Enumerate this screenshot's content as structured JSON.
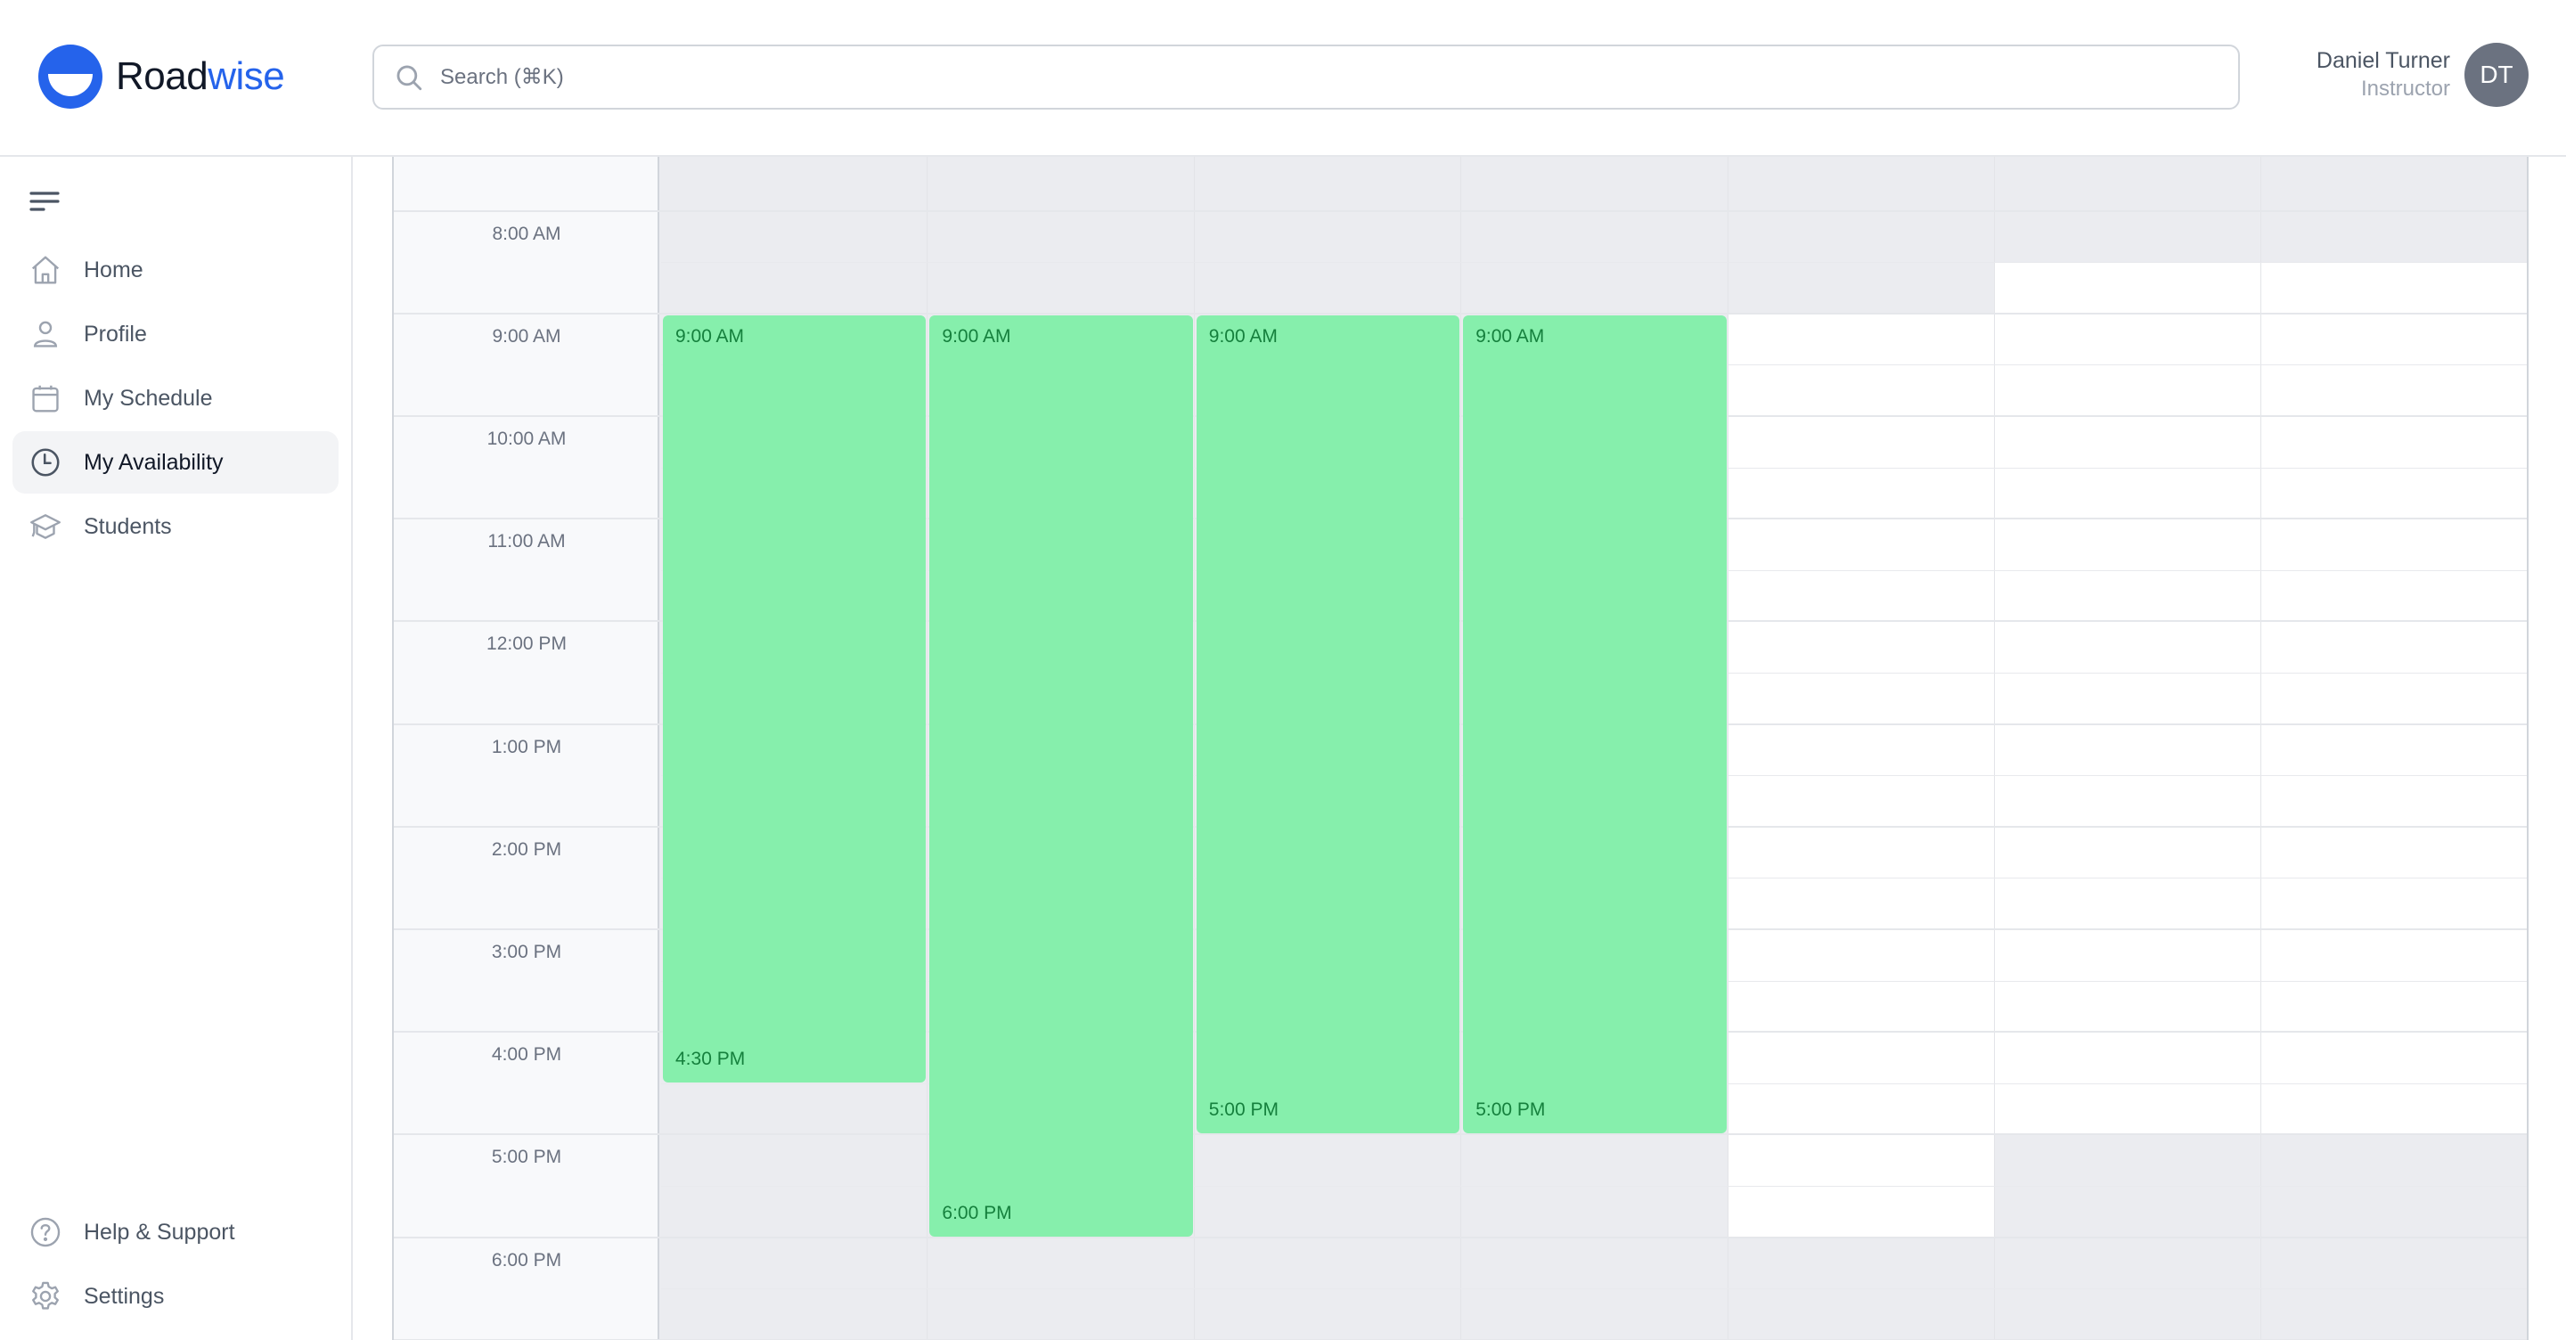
{
  "header": {
    "brand_part1": "Road",
    "brand_part2": "wise",
    "brand_color": "#2563eb",
    "search_placeholder": "Search (⌘K)",
    "search_value": "",
    "user_name": "Daniel Turner",
    "user_role": "Instructor",
    "avatar_initials": "DT"
  },
  "sidebar": {
    "menu_icon": "menu-icon",
    "items": [
      {
        "label": "Home",
        "icon": "home-icon",
        "active": false
      },
      {
        "label": "Profile",
        "icon": "user-icon",
        "active": false
      },
      {
        "label": "My Schedule",
        "icon": "calendar-icon",
        "active": false
      },
      {
        "label": "My Availability",
        "icon": "clock-icon",
        "active": true
      },
      {
        "label": "Students",
        "icon": "graduation-cap-icon",
        "active": false
      }
    ],
    "bottom_items": [
      {
        "label": "Help & Support",
        "icon": "help-circle-icon"
      },
      {
        "label": "Settings",
        "icon": "gear-icon"
      }
    ]
  },
  "calendar": {
    "visible_start_hour": 7.5,
    "hour_labels": [
      "8:00 AM",
      "9:00 AM",
      "10:00 AM",
      "11:00 AM",
      "12:00 PM",
      "1:00 PM",
      "2:00 PM",
      "3:00 PM",
      "4:00 PM",
      "5:00 PM",
      "6:00 PM"
    ],
    "label_hours": [
      8,
      9,
      10,
      11,
      12,
      13,
      14,
      15,
      16,
      17,
      18
    ],
    "days": [
      {
        "available_range": null,
        "block": {
          "start": 9,
          "end": 16.5,
          "start_label": "9:00 AM",
          "end_label": "4:30 PM"
        }
      },
      {
        "available_range": null,
        "block": {
          "start": 9,
          "end": 18,
          "start_label": "9:00 AM",
          "end_label": "6:00 PM"
        }
      },
      {
        "available_range": null,
        "block": {
          "start": 9,
          "end": 17,
          "start_label": "9:00 AM",
          "end_label": "5:00 PM"
        }
      },
      {
        "available_range": null,
        "block": {
          "start": 9,
          "end": 17,
          "start_label": "9:00 AM",
          "end_label": "5:00 PM"
        }
      },
      {
        "available_range": [
          9,
          18
        ],
        "block": null
      },
      {
        "available_range": [
          8.5,
          17
        ],
        "block": null
      },
      {
        "available_range": [
          8.5,
          17
        ],
        "block": null
      }
    ],
    "colors": {
      "block_fill": "#86efac",
      "block_text": "#15803d",
      "unavailable": "#ebecf0",
      "available": "#ffffff"
    }
  }
}
